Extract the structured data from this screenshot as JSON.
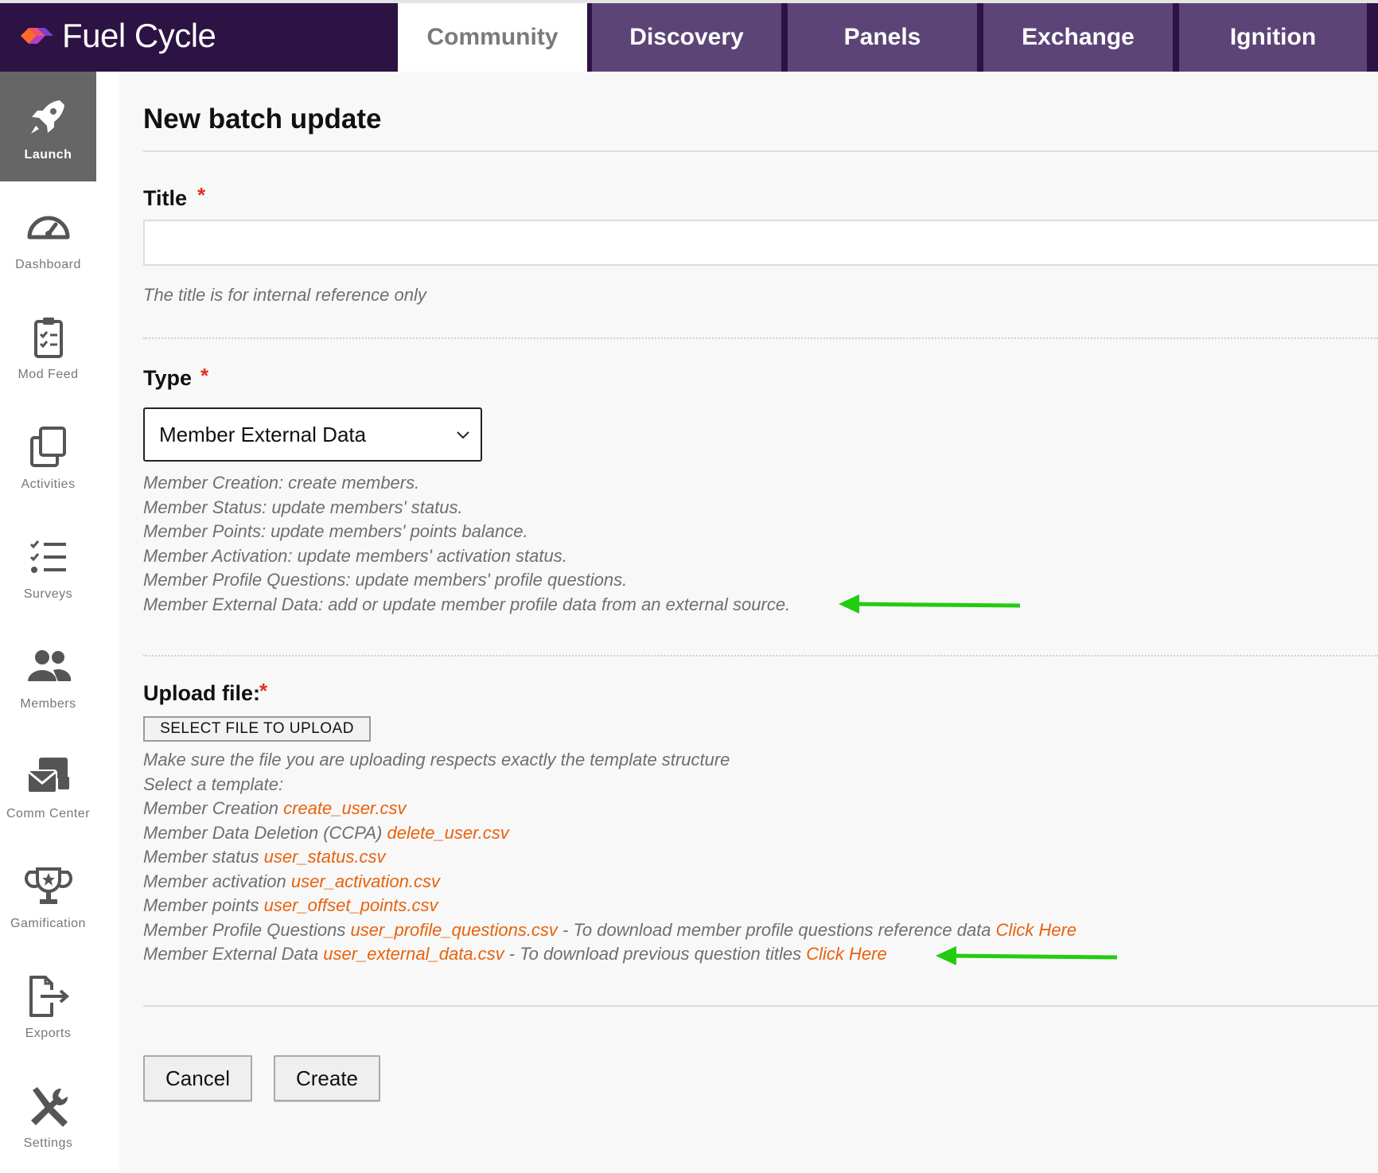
{
  "app": {
    "brand": "Fuel Cycle"
  },
  "tabs": [
    {
      "label": "Community",
      "active": true
    },
    {
      "label": "Discovery"
    },
    {
      "label": "Panels"
    },
    {
      "label": "Exchange"
    },
    {
      "label": "Ignition"
    }
  ],
  "sidebar": {
    "items": [
      {
        "label": "Launch",
        "icon": "rocket-icon",
        "active": true
      },
      {
        "label": "Dashboard",
        "icon": "gauge-icon"
      },
      {
        "label": "Mod Feed",
        "icon": "clipboard-icon"
      },
      {
        "label": "Activities",
        "icon": "copy-icon"
      },
      {
        "label": "Surveys",
        "icon": "checklist-icon"
      },
      {
        "label": "Members",
        "icon": "users-icon"
      },
      {
        "label": "Comm Center",
        "icon": "mail-icon"
      },
      {
        "label": "Gamification",
        "icon": "trophy-icon"
      },
      {
        "label": "Exports",
        "icon": "export-icon"
      },
      {
        "label": "Settings",
        "icon": "tools-icon"
      }
    ]
  },
  "page": {
    "title": "New batch update",
    "title_field": {
      "label": "Title",
      "required_mark": "*",
      "value": "",
      "help": "The title is for internal reference only"
    },
    "type_field": {
      "label": "Type",
      "required_mark": "*",
      "selected": "Member External Data",
      "help_lines": [
        "Member Creation: create members.",
        "Member Status: update members' status.",
        "Member Points: update members' points balance.",
        "Member Activation: update members' activation status.",
        "Member Profile Questions: update members' profile questions.",
        "Member External Data: add or update member profile data from an external source."
      ]
    },
    "upload_field": {
      "label": "Upload file:",
      "required_mark": "*",
      "button": "SELECT FILE TO UPLOAD",
      "help_intro": "Make sure the file you are uploading respects exactly the template structure",
      "select_template": "Select a template:",
      "templates": [
        {
          "name": "Member Creation",
          "file": "create_user.csv"
        },
        {
          "name": "Member Data Deletion (CCPA)",
          "file": "delete_user.csv"
        },
        {
          "name": "Member status",
          "file": "user_status.csv"
        },
        {
          "name": "Member activation",
          "file": "user_activation.csv"
        },
        {
          "name": "Member points",
          "file": "user_offset_points.csv"
        },
        {
          "name": "Member Profile Questions",
          "file": "user_profile_questions.csv",
          "extra": " - To download member profile questions reference data ",
          "link": "Click Here"
        },
        {
          "name": "Member External Data",
          "file": "user_external_data.csv",
          "extra": " - To download previous question titles ",
          "link": "Click Here"
        }
      ]
    },
    "actions": {
      "cancel": "Cancel",
      "create": "Create"
    }
  },
  "colors": {
    "topbar": "#2d1244",
    "tab": "#5c4477",
    "link": "#e8620c",
    "required": "#e0301e",
    "annotation_arrow": "#22cc11"
  }
}
